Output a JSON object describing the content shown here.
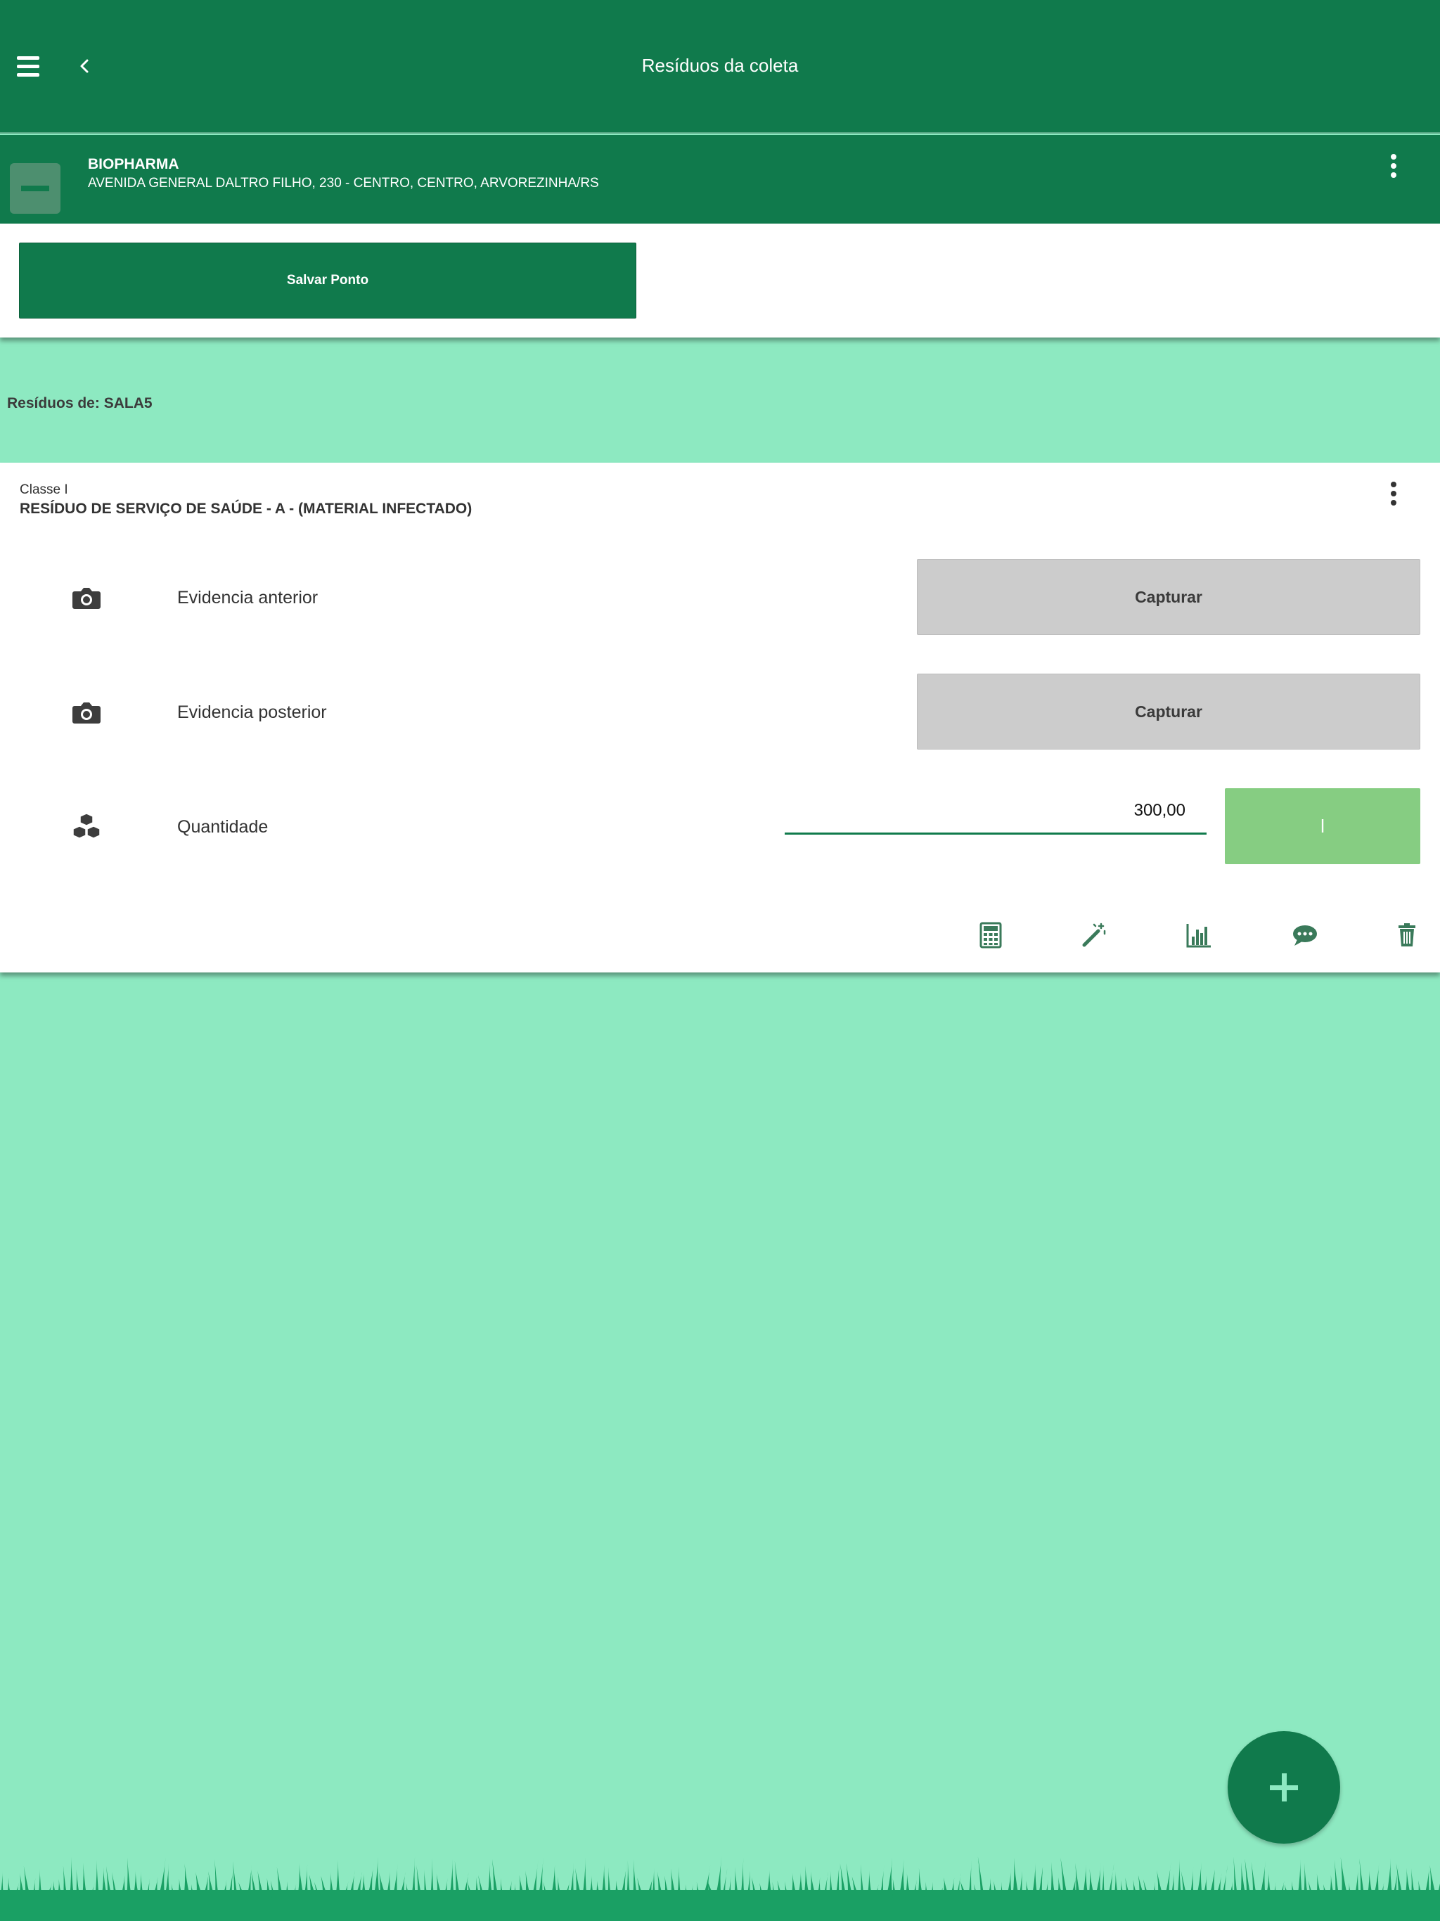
{
  "header": {
    "title": "Resíduos da coleta",
    "menu_icon": "hamburger-menu-icon",
    "back_icon": "chevron-left-icon"
  },
  "client": {
    "name": "BIOPHARMA",
    "address": "AVENIDA GENERAL DALTRO FILHO, 230 - CENTRO, CENTRO, ARVOREZINHA/RS"
  },
  "toolbar": {
    "save_label": "Salvar Ponto"
  },
  "section": {
    "title": "Resíduos de: SALA5"
  },
  "waste_item": {
    "class_label": "Classe I",
    "name": "RESÍDUO DE SERVIÇO DE SAÚDE - A - (MATERIAL INFECTADO)",
    "rows": {
      "evidence_before": {
        "label": "Evidencia anterior",
        "button_label": "Capturar",
        "icon": "camera-icon"
      },
      "evidence_after": {
        "label": "Evidencia posterior",
        "button_label": "Capturar",
        "icon": "camera-icon"
      },
      "quantity": {
        "label": "Quantidade",
        "value": "300,00",
        "unit_label": "l",
        "icon": "cubes-icon"
      }
    },
    "actions": [
      "calculator-icon",
      "magic-wand-icon",
      "bar-chart-icon",
      "comment-icon",
      "trash-icon"
    ]
  },
  "colors": {
    "primary": "#107a4c",
    "background": "#8de9c1",
    "unit_button": "#86cd82",
    "capture_button": "#cccccc"
  }
}
